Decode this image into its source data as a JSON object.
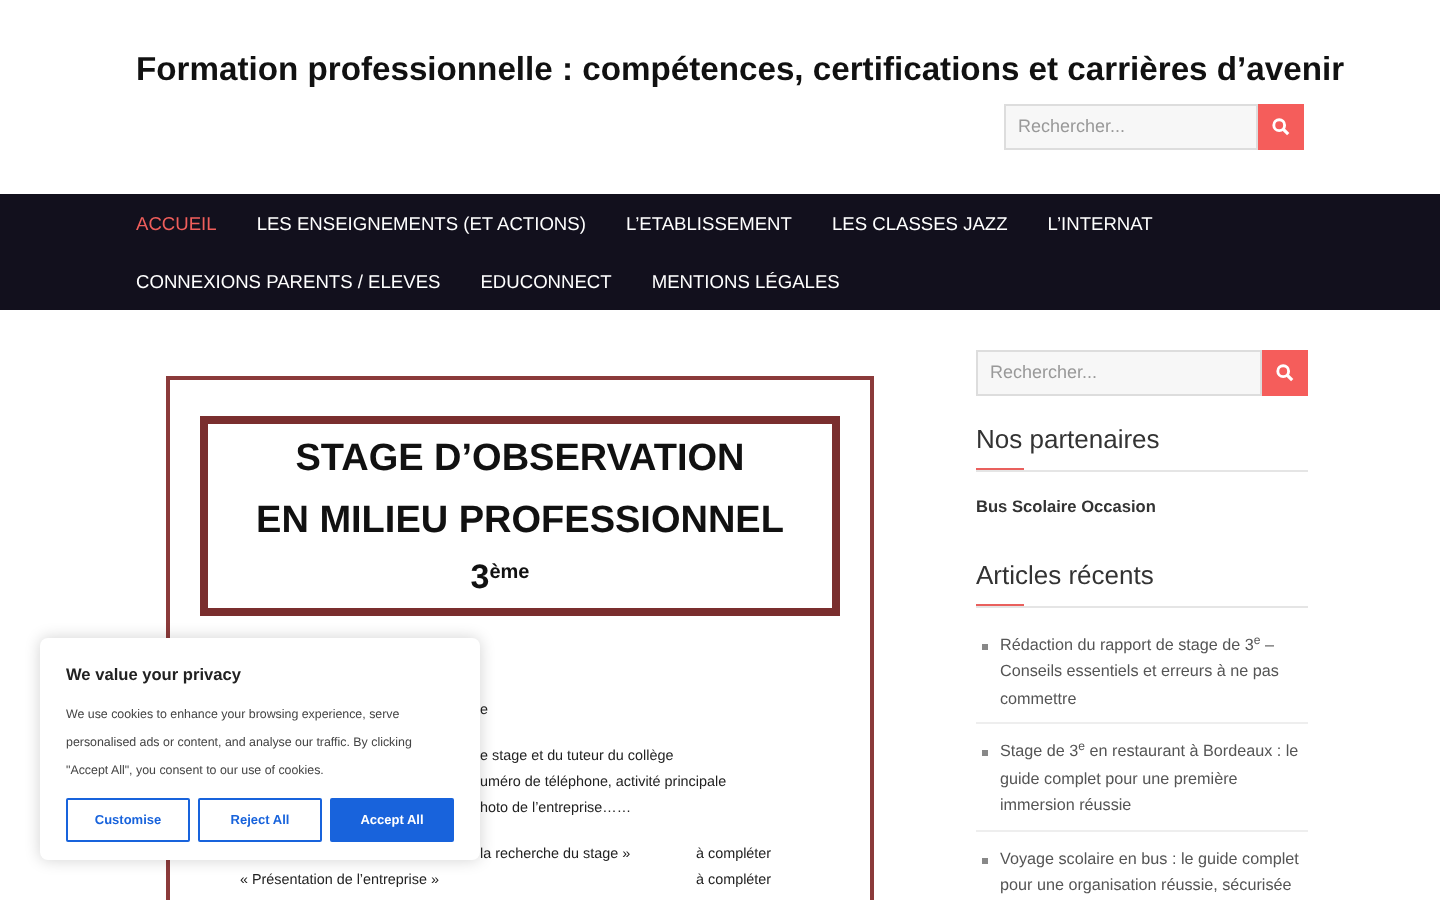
{
  "site_title": "Formation professionnelle : compétences, certifications et carrières d’avenir",
  "header_search": {
    "placeholder": "Rechercher..."
  },
  "nav": [
    {
      "label": "ACCUEIL",
      "selected": true
    },
    {
      "label": "LES ENSEIGNEMENTS (ET ACTIONS)",
      "selected": false
    },
    {
      "label": "L’ETABLISSEMENT",
      "selected": false
    },
    {
      "label": "LES CLASSES JAZZ",
      "selected": false
    },
    {
      "label": "L’INTERNAT",
      "selected": false
    },
    {
      "label": "CONNEXIONS PARENTS / ELEVES",
      "selected": false
    },
    {
      "label": "EDUCONNECT",
      "selected": false
    },
    {
      "label": "MENTIONS LÉGALES",
      "selected": false
    }
  ],
  "document": {
    "title_lines": [
      "STAGE D’OBSERVATION",
      "EN MILIEU PROFESSIONNEL"
    ],
    "grade": "3",
    "grade_sup": "ème",
    "lines": [
      {
        "kind": "partial",
        "text": "e"
      },
      {
        "kind": "gap"
      },
      {
        "kind": "partial",
        "text": "e stage et du tuteur du collège"
      },
      {
        "kind": "partial",
        "text": "uméro de téléphone, activité principale"
      },
      {
        "kind": "partial",
        "text": "hoto de l’entreprise……"
      },
      {
        "kind": "gap"
      },
      {
        "kind": "partial",
        "text": "la recherche du stage »",
        "status": "à compléter"
      },
      {
        "kind": "full",
        "text": "« Présentation de l’entreprise »",
        "status": "à compléter"
      }
    ]
  },
  "sidebar": {
    "search": {
      "placeholder": "Rechercher..."
    },
    "partners_title": "Nos partenaires",
    "partners": [
      "Bus Scolaire Occasion"
    ],
    "recent_title": "Articles récents",
    "recent": [
      "Rédaction du rapport de stage de 3$^{e}$ – Conseils essentiels et erreurs à ne pas commettre",
      "Stage de 3$^{e}$ en restaurant à Bordeaux : le guide complet pour une première immersion réussie",
      "Voyage scolaire en bus : le guide complet pour une organisation réussie, sécurisée"
    ]
  },
  "cookie": {
    "title": "We value your privacy",
    "text": "We use cookies to enhance your browsing experience, serve personalised ads or content, and analyse our traffic. By clicking \"Accept All\", you consent to our use of cookies.",
    "buttons": [
      {
        "label": "Customise",
        "kind": "outline"
      },
      {
        "label": "Reject All",
        "kind": "outline"
      },
      {
        "label": "Accept All",
        "kind": "primary"
      }
    ]
  }
}
